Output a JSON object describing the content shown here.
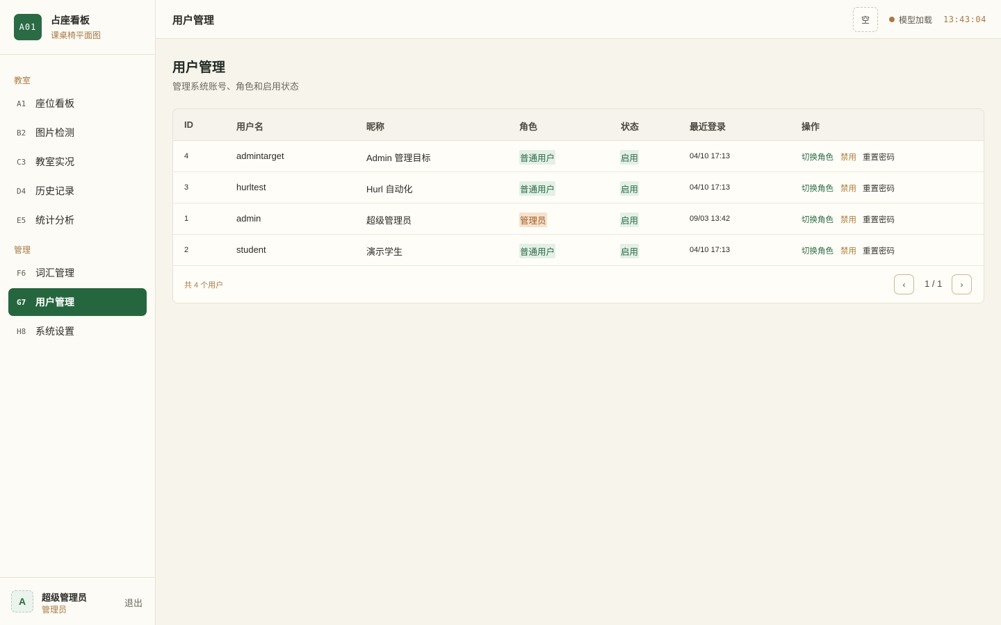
{
  "brand": {
    "logo": "A01",
    "title": "占座看板",
    "subtitle": "课桌椅平面图"
  },
  "sidebar": {
    "sections": [
      {
        "label": "教室"
      },
      {
        "label": "管理"
      }
    ],
    "items": [
      {
        "code": "A1",
        "label": "座位看板"
      },
      {
        "code": "B2",
        "label": "图片检测"
      },
      {
        "code": "C3",
        "label": "教室实况"
      },
      {
        "code": "D4",
        "label": "历史记录"
      },
      {
        "code": "E5",
        "label": "统计分析"
      },
      {
        "code": "F6",
        "label": "词汇管理"
      },
      {
        "code": "G7",
        "label": "用户管理",
        "active": true
      },
      {
        "code": "H8",
        "label": "系统设置"
      }
    ],
    "user": {
      "avatar": "A",
      "name": "超级管理员",
      "role": "管理员",
      "logout": "退出"
    }
  },
  "topbar": {
    "title": "用户管理",
    "empty_button": "空",
    "model_status": "模型加载",
    "clock": "13:43:04"
  },
  "main": {
    "title": "用户管理",
    "description": "管理系统账号、角色和启用状态"
  },
  "table": {
    "headers": [
      "ID",
      "用户名",
      "昵称",
      "角色",
      "状态",
      "最近登录",
      "操作"
    ],
    "rows": [
      {
        "id": "4",
        "username": "admintarget",
        "nickname": "Admin 管理目标",
        "role": "普通用户",
        "status": "启用",
        "last_login": "04/10 17:13"
      },
      {
        "id": "3",
        "username": "hurltest",
        "nickname": "Hurl 自动化",
        "role": "普通用户",
        "status": "启用",
        "last_login": "04/10 17:13"
      },
      {
        "id": "1",
        "username": "admin",
        "nickname": "超级管理员",
        "role": "管理员",
        "status": "启用",
        "last_login": "09/03 13:42"
      },
      {
        "id": "2",
        "username": "student",
        "nickname": "演示学生",
        "role": "普通用户",
        "status": "启用",
        "last_login": "04/10 17:13"
      }
    ],
    "actions": {
      "switch_role": "切换角色",
      "disable": "禁用",
      "reset_password": "重置密码"
    },
    "footer": {
      "count": "共 4 个用户",
      "page": "1 / 1",
      "prev": "‹",
      "next": "›"
    }
  },
  "colors": {
    "accent": "#25663f",
    "warm": "#a97a45",
    "background": "#f7f4ec"
  }
}
